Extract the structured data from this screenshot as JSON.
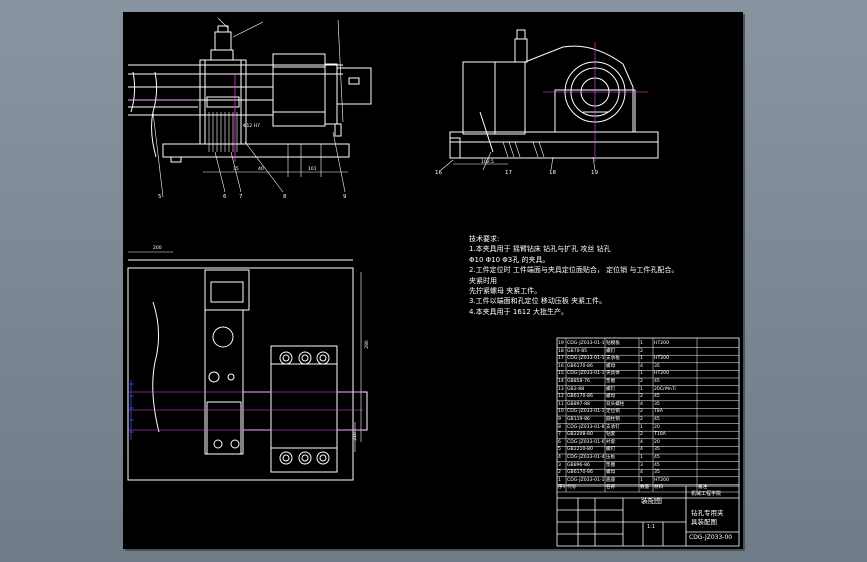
{
  "notes": {
    "heading": "技术要求:",
    "lines": [
      "1.本夹具用于 摇臂钻床 钻孔与扩孔 攻丝 钻孔",
      "Φ10 Φ10 Φ3孔 的夹具。",
      "2.工件定位时 工件端面与夹具定位面贴合， 定位销 与工件孔配合。",
      "夹紧时用",
      "先拧紧螺母 夹紧工件。",
      "3.工件以端面和孔定位 移动压板 夹紧工件。",
      "4.本夹具用于 1612 大批生产。"
    ]
  },
  "part_labels": [
    "5",
    "6",
    "7",
    "8",
    "9",
    "16",
    "17",
    "18",
    "19"
  ],
  "dims": [
    "Φ12 H7",
    "35",
    "40",
    "101",
    "102.5",
    "200",
    "280",
    "210"
  ],
  "bom_rows": [
    [
      "19",
      "CDG-JZ033-01-19",
      "钻模板",
      "1",
      "HT200",
      ""
    ],
    [
      "18",
      "GB70-85",
      "螺钉",
      "2",
      "",
      ""
    ],
    [
      "17",
      "CDG-JZ033-01-17",
      "支承板",
      "1",
      "HT200",
      ""
    ],
    [
      "16",
      "GB6170-86",
      "螺母",
      "4",
      "35",
      ""
    ],
    [
      "15",
      "CDG-JZ033-01-15",
      "夹具体",
      "1",
      "HT200",
      ""
    ],
    [
      "14",
      "GB858-76",
      "垫圈",
      "2",
      "45",
      ""
    ],
    [
      "13",
      "GB2-88",
      "螺钉",
      "1",
      "20CrMnTi",
      ""
    ],
    [
      "12",
      "GB6170-86",
      "螺母",
      "2",
      "45",
      ""
    ],
    [
      "11",
      "GB897-88",
      "双头螺柱",
      "4",
      "35",
      ""
    ],
    [
      "10",
      "CDG-JZ033-01-10",
      "定位销",
      "2",
      "T8A",
      ""
    ],
    [
      "9",
      "GB119-86",
      "圆柱销",
      "2",
      "45",
      ""
    ],
    [
      "8",
      "CDG-JZ033-01-8",
      "支承钉",
      "1",
      "20",
      ""
    ],
    [
      "7",
      "GB2208-80",
      "钻套",
      "2",
      "T10A",
      ""
    ],
    [
      "6",
      "CDG-JZ033-01-6",
      "衬套",
      "4",
      "20",
      ""
    ],
    [
      "5",
      "GB2210-80",
      "螺钉",
      "4",
      "35",
      ""
    ],
    [
      "4",
      "CDG-JZ033-01-4",
      "压板",
      "1",
      "45",
      ""
    ],
    [
      "3",
      "GB896-86",
      "垫圈",
      "3",
      "45",
      ""
    ],
    [
      "2",
      "GB6170-86",
      "螺母",
      "4",
      "35",
      ""
    ],
    [
      "1",
      "CDG-JZ033-01-1",
      "底座",
      "1",
      "HT200",
      ""
    ]
  ],
  "bom_header": [
    "序号",
    "代号",
    "名称",
    "数量",
    "材料",
    "备注"
  ],
  "title_block": {
    "assembly": "装配图",
    "name_line1": "钻孔专用夹",
    "name_line2": "具装配图",
    "school": "机械工程学院",
    "drawing_no": "CDG-JZ033-00",
    "scale": "1:1"
  }
}
